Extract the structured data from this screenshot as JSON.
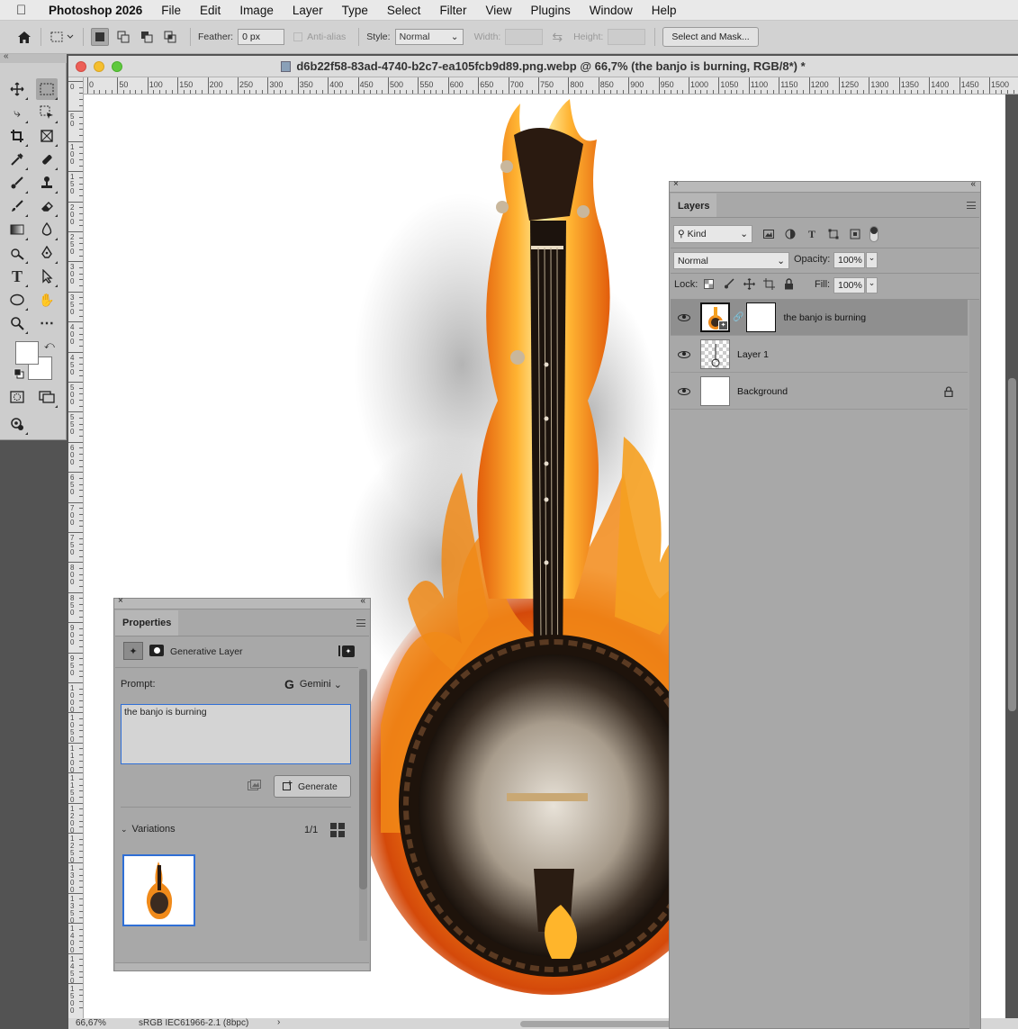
{
  "menubar": {
    "app_name": "Photoshop 2026",
    "items": [
      "File",
      "Edit",
      "Image",
      "Layer",
      "Type",
      "Select",
      "Filter",
      "View",
      "Plugins",
      "Window",
      "Help"
    ]
  },
  "options_bar": {
    "feather_label": "Feather:",
    "feather_value": "0 px",
    "antialias_label": "Anti-alias",
    "style_label": "Style:",
    "style_value": "Normal",
    "width_label": "Width:",
    "height_label": "Height:",
    "select_mask_label": "Select and Mask..."
  },
  "document": {
    "title": "d6b22f58-83ad-4740-b2c7-ea105fcb9d89.png.webp @ 66,7% (the banjo is burning, RGB/8*) *",
    "ruler_h": [
      "0",
      "50",
      "100",
      "150",
      "200",
      "250",
      "300",
      "350",
      "400",
      "450",
      "500",
      "550",
      "600",
      "650",
      "700",
      "750",
      "800",
      "850",
      "900",
      "950",
      "1000",
      "1050",
      "1100",
      "1150",
      "1200",
      "1250",
      "1300",
      "1350",
      "1400",
      "1450",
      "1500"
    ],
    "ruler_v": [
      "0",
      "50",
      "100",
      "150",
      "200",
      "250",
      "300",
      "350",
      "400",
      "450",
      "500",
      "550",
      "600",
      "650",
      "700",
      "750",
      "800",
      "850",
      "900",
      "950",
      "1000",
      "1050",
      "1100",
      "1150",
      "1200",
      "1250",
      "1300",
      "1350",
      "1400",
      "1450",
      "1500"
    ],
    "zoom": "66,67%",
    "color_profile": "sRGB IEC61966-2.1 (8bpc)"
  },
  "layers_panel": {
    "tab_label": "Layers",
    "filter_kind": "Kind",
    "blend_mode": "Normal",
    "opacity_label": "Opacity:",
    "opacity_value": "100%",
    "lock_label": "Lock:",
    "fill_label": "Fill:",
    "fill_value": "100%",
    "layers": [
      {
        "name": "the banjo is burning",
        "selected": true,
        "visible": true
      },
      {
        "name": "Layer 1",
        "selected": false,
        "visible": true
      },
      {
        "name": "Background",
        "selected": false,
        "visible": true,
        "locked": true
      }
    ]
  },
  "properties_panel": {
    "tab_label": "Properties",
    "layer_type": "Generative Layer",
    "prompt_label": "Prompt:",
    "model": "Gemini",
    "prompt_text": "the banjo is burning",
    "generate_label": "Generate",
    "variations_label": "Variations",
    "variations_count": "1/1"
  },
  "colors": {
    "accent_blue": "#2f6fd6",
    "panel_bg": "#a8a8a8",
    "flame_orange": "#f08a1a"
  }
}
